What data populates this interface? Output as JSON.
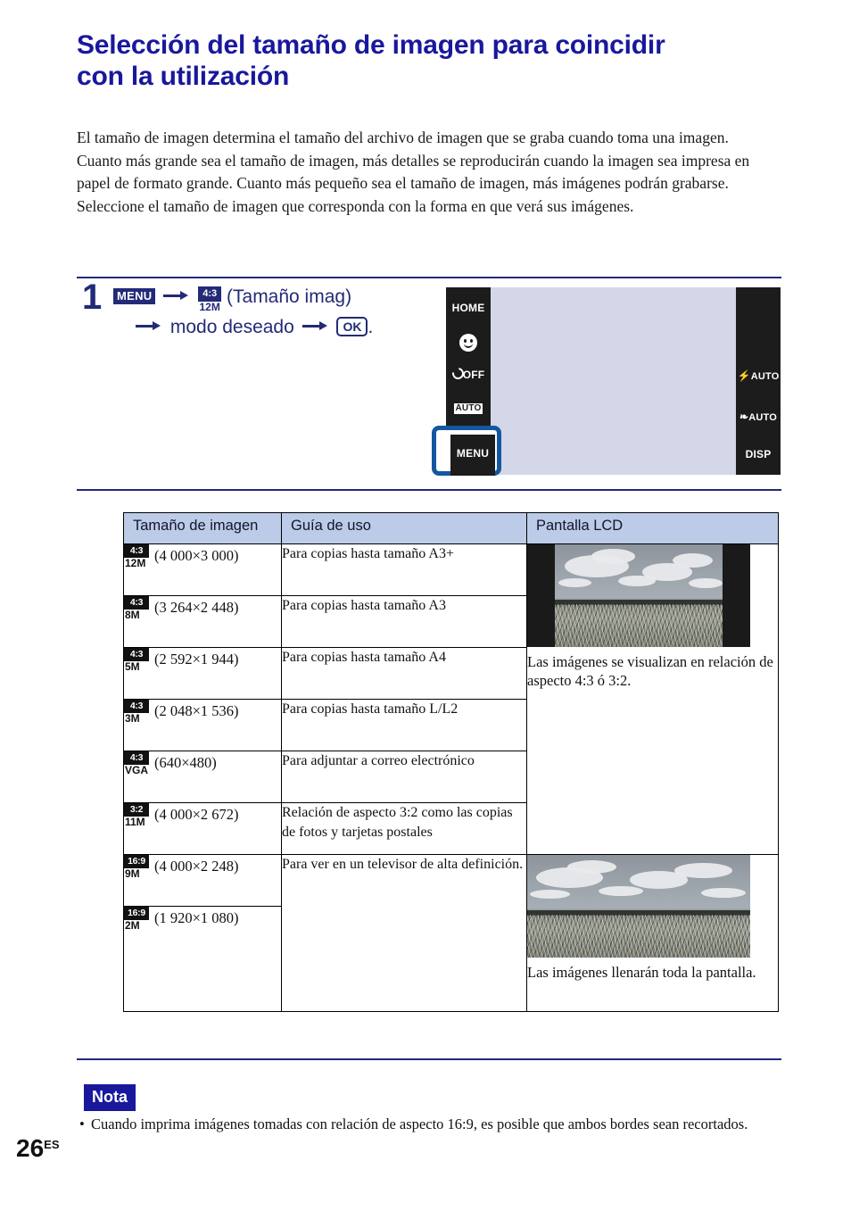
{
  "title": "Selección del tamaño de imagen para coincidir con la utilización",
  "intro": {
    "p1": "El tamaño de imagen determina el tamaño del archivo de imagen que se graba cuando toma una imagen.",
    "p2": "Cuanto más grande sea el tamaño de imagen, más detalles se reproducirán cuando la imagen sea impresa en papel de formato grande. Cuanto más pequeño sea el tamaño de imagen, más imágenes podrán grabarse. Seleccione el tamaño de imagen que corresponda con la forma en que verá sus imágenes."
  },
  "step": {
    "number": "1",
    "menu_badge": "MENU",
    "icon_ratio": "4:3",
    "icon_mp": "12M",
    "label_paren": "(Tamaño imag)",
    "mode_text": "modo deseado",
    "ok_button": "OK",
    "period": "."
  },
  "lcd_mock": {
    "left_items": [
      {
        "label": "HOME",
        "icon": "home-label"
      },
      {
        "label": "",
        "icon": "smile-shutter-icon"
      },
      {
        "label": "OFF",
        "icon": "self-timer-off-icon"
      },
      {
        "label": "AUTO",
        "icon": "iauto-mode-icon"
      },
      {
        "label": "MENU",
        "icon": "menu-label"
      }
    ],
    "right_items": [
      {
        "label": "AUTO",
        "icon": "flash-auto-icon"
      },
      {
        "label": "AUTO",
        "icon": "macro-auto-icon"
      },
      {
        "label": "DISP",
        "icon": "disp-label"
      }
    ],
    "highlight_label": "MENU",
    "highlight_color": "#1457a0"
  },
  "table": {
    "headers": [
      "Tamaño de imagen",
      "Guía de uso",
      "Pantalla LCD"
    ],
    "rows": [
      {
        "ratio": "4:3",
        "mp": "12M",
        "dim": "(4 000×3 000)",
        "guide": "Para copias hasta tamaño A3+"
      },
      {
        "ratio": "4:3",
        "mp": "8M",
        "dim": "(3 264×2 448)",
        "guide": "Para copias hasta tamaño A3"
      },
      {
        "ratio": "4:3",
        "mp": "5M",
        "dim": "(2 592×1 944)",
        "guide": "Para copias hasta tamaño A4"
      },
      {
        "ratio": "4:3",
        "mp": "3M",
        "dim": "(2 048×1 536)",
        "guide": "Para copias hasta tamaño L/L2"
      },
      {
        "ratio": "4:3",
        "mp": "VGA",
        "dim": "(640×480)",
        "guide": "Para adjuntar a correo electrónico"
      },
      {
        "ratio": "3:2",
        "mp": "11M",
        "dim": "(4 000×2 672)",
        "guide": "Relación de aspecto 3:2 como las copias de fotos y tarjetas postales"
      },
      {
        "ratio": "16:9",
        "mp": "9M",
        "dim": "(4 000×2 248)",
        "guide": "Para ver en un televisor de alta definición."
      },
      {
        "ratio": "16:9",
        "mp": "2M",
        "dim": "(1 920×1 080)",
        "guide": ""
      }
    ],
    "lcd_cells": [
      {
        "caption": "Las imágenes se visualizan en relación de aspecto 4:3 ó 3:2.",
        "photo": "field-photo-letterboxed"
      },
      {
        "caption": "Las imágenes llenarán toda la pantalla.",
        "photo": "field-photo-fullwidth"
      }
    ]
  },
  "footer": {
    "nota_label": "Nota",
    "bullet": "•",
    "nota_text": "Cuando imprima imágenes tomadas con relación de aspecto 16:9, es posible que ambos bordes sean recortados.",
    "page_number": "26",
    "page_suffix": "ES"
  },
  "colors": {
    "title_blue": "#19189c",
    "step_navy": "#232a77",
    "table_header": "#bccbe8",
    "highlight_blue": "#1457a0"
  }
}
